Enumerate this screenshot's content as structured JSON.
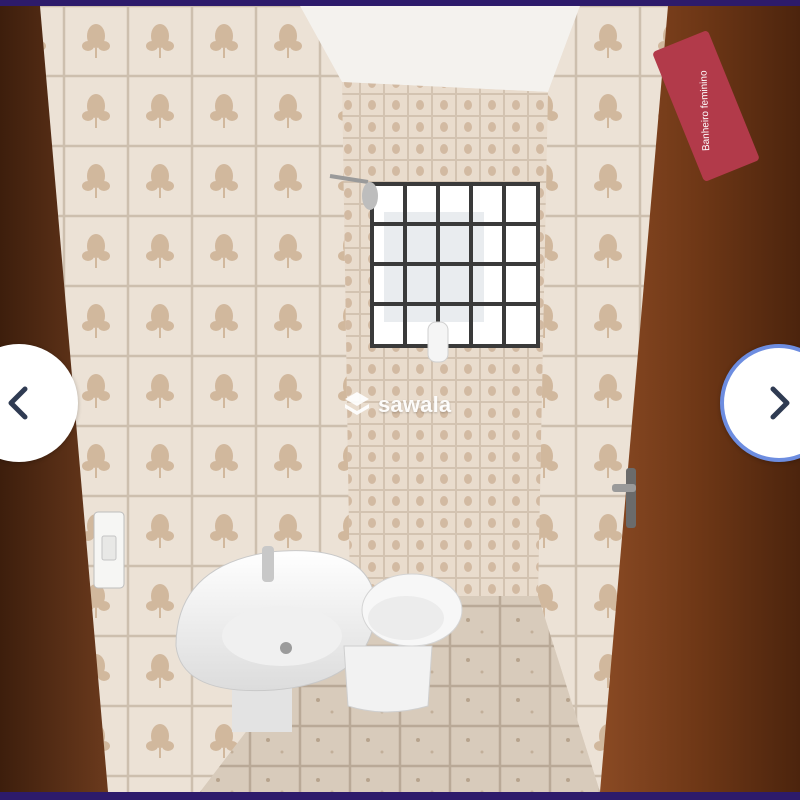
{
  "viewer": {
    "watermark_text": "sawala",
    "watermark_icon": "sawala-logo-icon",
    "prev_icon": "chevron-left-icon",
    "next_icon": "chevron-right-icon"
  },
  "photo": {
    "door_sign_text": "Banheiro feminino"
  },
  "colors": {
    "frame": "#2d1b6b",
    "next_button_ring": "#6d8de0",
    "door_sign": "#b23a4a"
  }
}
